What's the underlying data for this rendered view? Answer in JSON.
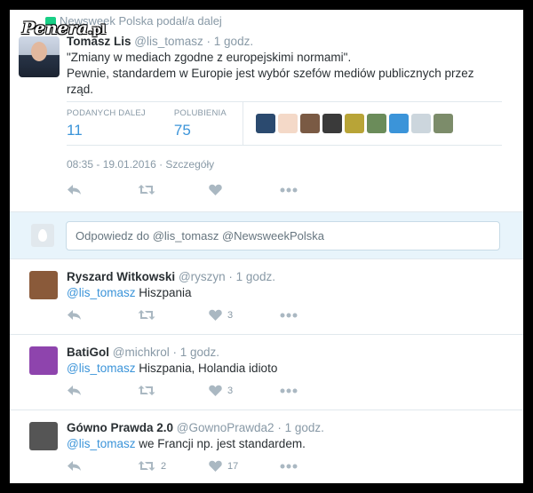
{
  "watermark": {
    "text": "Penera",
    "suffix": ".pl"
  },
  "main_tweet": {
    "retweet_context": "Newsweek Polska podał/a dalej",
    "author_name": "Tomasz Lis",
    "author_handle": "@lis_tomasz",
    "time": "· 1 godz.",
    "text_line1": "\"Zmiany w mediach zgodne z europejskimi normami\".",
    "text_line2": "Pewnie, standardem w Europie jest wybór szefów mediów publicznych przez rząd.",
    "retweets_label": "PODANYCH DALEJ",
    "retweets_value": "11",
    "likes_label": "POLUBIENIA",
    "likes_value": "75",
    "timestamp": "08:35 - 19.01.2016 · Szczegóły",
    "liker_colors": [
      "#2b4a6f",
      "#f4d9c8",
      "#7a5a44",
      "#3a3a3a",
      "#b8a437",
      "#6b8c5a",
      "#3b94d9",
      "#ccd6dd",
      "#7c8c6a"
    ]
  },
  "reply_box": {
    "placeholder": "Odpowiedz do @lis_tomasz @NewsweekPolska"
  },
  "replies": [
    {
      "name": "Ryszard Witkowski",
      "handle": "@ryszyn",
      "time": "· 1 godz.",
      "mention": "@lis_tomasz",
      "text": " Hiszpania",
      "retweets": "",
      "likes": "3",
      "avatar_color": "#8a5a3a"
    },
    {
      "name": "BatiGol",
      "handle": "@michkrol",
      "time": "· 1 godz.",
      "mention": "@lis_tomasz",
      "text": " Hiszpania, Holandia idioto",
      "retweets": "",
      "likes": "3",
      "avatar_color": "#8e44ad"
    },
    {
      "name": "Gówno Prawda 2.0",
      "handle": "@GownoPrawda2",
      "time": "· 1 godz.",
      "mention": "@lis_tomasz",
      "text": " we Francji np. jest standardem.",
      "retweets": "2",
      "likes": "17",
      "avatar_color": "#555555"
    }
  ],
  "icons": {
    "reply": "reply-icon",
    "retweet": "retweet-icon",
    "like": "heart-icon",
    "more": "more-icon"
  }
}
